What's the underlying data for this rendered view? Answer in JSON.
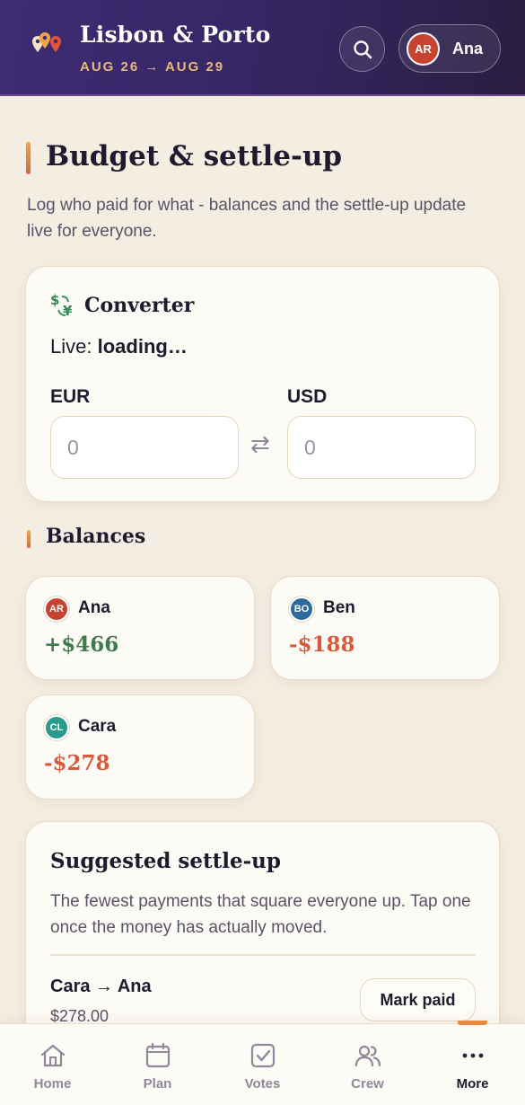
{
  "header": {
    "trip_title": "Lisbon & Porto",
    "trip_dates": "AUG 26 → AUG 29",
    "user_initials": "AR",
    "user_name": "Ana"
  },
  "page": {
    "title": "Budget & settle-up",
    "subtitle": "Log who paid for what - balances and the settle-up update live for everyone."
  },
  "converter": {
    "title": "Converter",
    "icon": "currency-exchange-icon",
    "live_label": "Live:",
    "live_status": "loading…",
    "from_currency": "EUR",
    "to_currency": "USD",
    "from_placeholder": "0",
    "to_placeholder": "0"
  },
  "balances": {
    "title": "Balances",
    "people": [
      {
        "initials": "AR",
        "name": "Ana",
        "amount": "+$466",
        "color": "#c8432f",
        "amount_color": "#3f7a4c"
      },
      {
        "initials": "BO",
        "name": "Ben",
        "amount": "-$188",
        "color": "#2f6a9e",
        "amount_color": "#d75b3b"
      },
      {
        "initials": "CL",
        "name": "Cara",
        "amount": "-$278",
        "color": "#2a9a8a",
        "amount_color": "#d75b3b"
      }
    ]
  },
  "settle": {
    "title": "Suggested settle-up",
    "subtitle": "The fewest payments that square everyone up. Tap one once the money has actually moved.",
    "payments": [
      {
        "route": "Cara → Ana",
        "amount": "$278.00",
        "action": "Mark paid"
      }
    ]
  },
  "tabs": [
    {
      "label": "Home",
      "icon": "home-icon"
    },
    {
      "label": "Plan",
      "icon": "calendar-icon"
    },
    {
      "label": "Votes",
      "icon": "checkbox-icon"
    },
    {
      "label": "Crew",
      "icon": "people-icon"
    },
    {
      "label": "More",
      "icon": "more-dots-icon",
      "active": true
    }
  ],
  "colors": {
    "header_bg": "#362766",
    "accent": "#e98a3f",
    "positive": "#3f7a4c",
    "negative": "#d75b3b",
    "page_bg": "#f4ede2"
  }
}
